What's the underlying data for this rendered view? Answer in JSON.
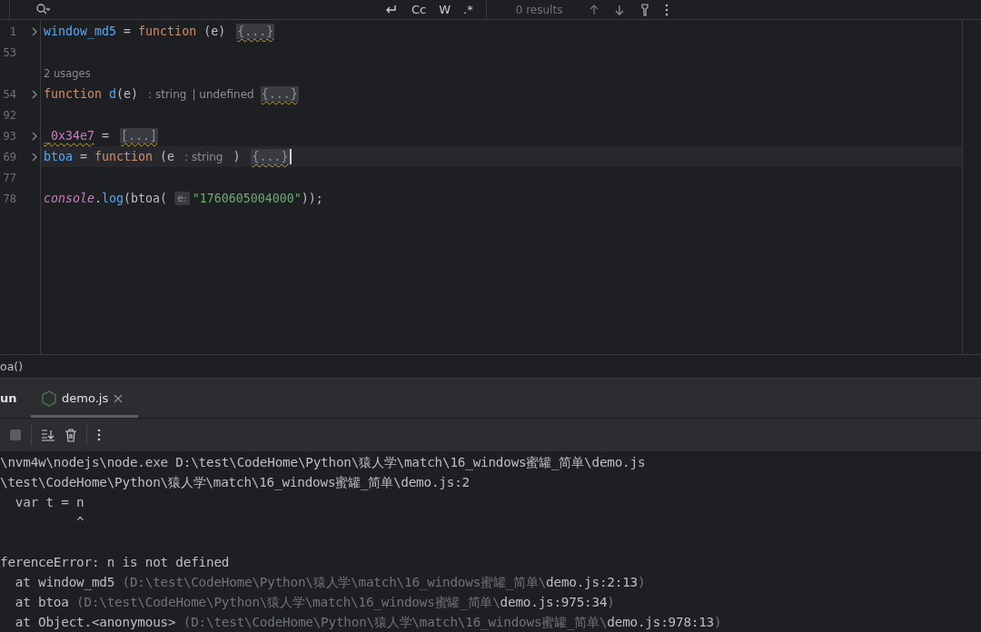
{
  "search_bar": {
    "toggles": [
      "Cc",
      "W",
      ".*"
    ],
    "results": "0 results"
  },
  "editor": {
    "lines": [
      {
        "number": "1",
        "foldable": true,
        "current": false,
        "cursor": false,
        "tokens": [
          {
            "kind": "fn",
            "text": "window_md5"
          },
          {
            "kind": "punct",
            "text": " = "
          },
          {
            "kind": "kw",
            "text": "function"
          },
          {
            "kind": "punct",
            "text": " (e) "
          },
          {
            "kind": "fold",
            "text": "{...}"
          }
        ]
      },
      {
        "number": "53",
        "foldable": false,
        "current": false,
        "cursor": false
      },
      {
        "foldable": false,
        "current": false,
        "cursor": false,
        "tokens": [
          {
            "kind": "usages",
            "text": "2 usages"
          }
        ]
      },
      {
        "number": "54",
        "foldable": true,
        "current": false,
        "cursor": false,
        "tokens": [
          {
            "kind": "kw",
            "text": "function "
          },
          {
            "kind": "fn",
            "text": "d"
          },
          {
            "kind": "punct",
            "text": "(e) "
          },
          {
            "kind": "hint",
            "text": ": string"
          },
          {
            "kind": "hint",
            "text": "| undefined"
          },
          {
            "kind": "fold",
            "text": "{...}"
          }
        ]
      },
      {
        "number": "92",
        "foldable": false,
        "current": false,
        "cursor": false
      },
      {
        "number": "93",
        "foldable": true,
        "current": false,
        "cursor": false,
        "tokens": [
          {
            "kind": "field",
            "text": "_0x34e7"
          },
          {
            "kind": "punct",
            "text": " = "
          },
          {
            "kind": "fold",
            "text": "[...]"
          }
        ]
      },
      {
        "number": "69",
        "foldable": true,
        "current": true,
        "cursor": true,
        "tokens": [
          {
            "kind": "fn",
            "text": "btoa"
          },
          {
            "kind": "punct",
            "text": " = "
          },
          {
            "kind": "kw",
            "text": "function"
          },
          {
            "kind": "punct",
            "text": " (e "
          },
          {
            "kind": "hint",
            "text": ": string"
          },
          {
            "kind": "punct",
            "text": " ) "
          },
          {
            "kind": "fold",
            "text": "{...}"
          }
        ]
      },
      {
        "number": "77",
        "foldable": false,
        "current": false,
        "cursor": false
      },
      {
        "number": "78",
        "foldable": false,
        "current": false,
        "cursor": false,
        "tokens": [
          {
            "kind": "global",
            "text": "console"
          },
          {
            "kind": "punct",
            "text": "."
          },
          {
            "kind": "fn",
            "text": "log"
          },
          {
            "kind": "punct",
            "text": "(btoa( "
          },
          {
            "kind": "param",
            "text": "e:"
          },
          {
            "kind": "str",
            "text": "\"1760605004000\""
          },
          {
            "kind": "punct",
            "text": "));"
          }
        ]
      }
    ]
  },
  "breadcrumb": "oa()",
  "run_panel": {
    "title": "un",
    "tabs": [
      {
        "label": "demo.js",
        "selected": true
      }
    ],
    "stop_disabled": true,
    "console": [
      {
        "segments": [
          {
            "kind": "normal",
            "text": "\\nvm4w\\nodejs\\node.exe D:\\test\\CodeHome\\Python\\猿人学\\match\\16_windows蜜罐_简单\\demo.js"
          }
        ]
      },
      {
        "segments": [
          {
            "kind": "normal",
            "text": "\\test\\CodeHome\\Python\\猿人学\\match\\16_windows蜜罐_简单\\demo.js:2"
          }
        ]
      },
      {
        "segments": [
          {
            "kind": "normal",
            "text": "  var t = n"
          }
        ]
      },
      {
        "segments": [
          {
            "kind": "normal",
            "text": "          ^"
          }
        ]
      },
      {
        "spaced": true,
        "segments": [
          {
            "kind": "normal",
            "text": "ferenceError: n is not defined"
          }
        ]
      },
      {
        "segments": [
          {
            "kind": "normal",
            "text": "  at window_md5 "
          },
          {
            "kind": "dim",
            "text": "(D:\\test\\CodeHome\\Python\\猿人学\\match\\16_windows蜜罐_简单\\"
          },
          {
            "kind": "normal",
            "text": "demo.js:2:13"
          },
          {
            "kind": "dim",
            "text": ")"
          }
        ]
      },
      {
        "segments": [
          {
            "kind": "normal",
            "text": "  at btoa "
          },
          {
            "kind": "dim",
            "text": "(D:\\test\\CodeHome\\Python\\猿人学\\match\\16_windows蜜罐_简单\\"
          },
          {
            "kind": "normal",
            "text": "demo.js:975:34"
          },
          {
            "kind": "dim",
            "text": ")"
          }
        ]
      },
      {
        "segments": [
          {
            "kind": "normal",
            "text": "  at Object.<anonymous> "
          },
          {
            "kind": "dim",
            "text": "(D:\\test\\CodeHome\\Python\\猿人学\\match\\16_windows蜜罐_简单\\"
          },
          {
            "kind": "normal",
            "text": "demo.js:978:13"
          },
          {
            "kind": "dim",
            "text": ")"
          }
        ]
      }
    ]
  }
}
